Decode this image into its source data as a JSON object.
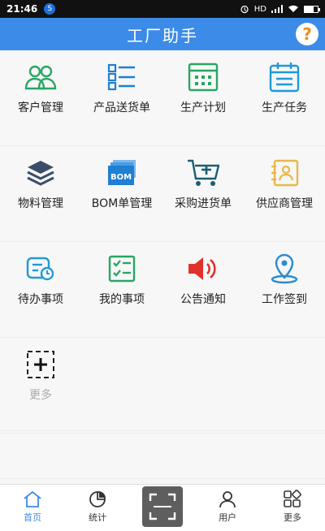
{
  "status": {
    "time": "21:46",
    "app_icon": "S",
    "signal": "HD"
  },
  "header": {
    "title": "工厂助手",
    "help": "?"
  },
  "grid": [
    {
      "label": "客户管理",
      "icon": "customers-icon",
      "color": "#2aa564"
    },
    {
      "label": "产品送货单",
      "icon": "list-icon",
      "color": "#1e7fd3"
    },
    {
      "label": "生产计划",
      "icon": "calendar-grid-icon",
      "color": "#2aa564"
    },
    {
      "label": "生产任务",
      "icon": "calendar-icon",
      "color": "#1e9ad8"
    },
    {
      "label": "物料管理",
      "icon": "layers-icon",
      "color": "#3a4e6a"
    },
    {
      "label": "BOM单管理",
      "icon": "bom-icon",
      "color": "#1e7fd3"
    },
    {
      "label": "采购进货单",
      "icon": "cart-icon",
      "color": "#1c5d73"
    },
    {
      "label": "供应商管理",
      "icon": "contact-card-icon",
      "color": "#e8b84a"
    },
    {
      "label": "待办事项",
      "icon": "todo-icon",
      "color": "#1e9ad8"
    },
    {
      "label": "我的事项",
      "icon": "checklist-icon",
      "color": "#2aa564"
    },
    {
      "label": "公告通知",
      "icon": "speaker-icon",
      "color": "#e0312a"
    },
    {
      "label": "工作签到",
      "icon": "location-icon",
      "color": "#2a8bd0"
    },
    {
      "label": "更多",
      "icon": "add-more-icon",
      "color": "#222"
    }
  ],
  "tabbar": [
    {
      "label": "首页",
      "icon": "home-icon"
    },
    {
      "label": "统计",
      "icon": "pie-chart-icon"
    },
    {
      "label": "",
      "icon": "scan-icon"
    },
    {
      "label": "用户",
      "icon": "user-icon"
    },
    {
      "label": "更多",
      "icon": "more-grid-icon"
    }
  ],
  "colors": {
    "header": "#3d8be8",
    "active_tab": "#3d8be8",
    "help": "#f08a1c"
  }
}
